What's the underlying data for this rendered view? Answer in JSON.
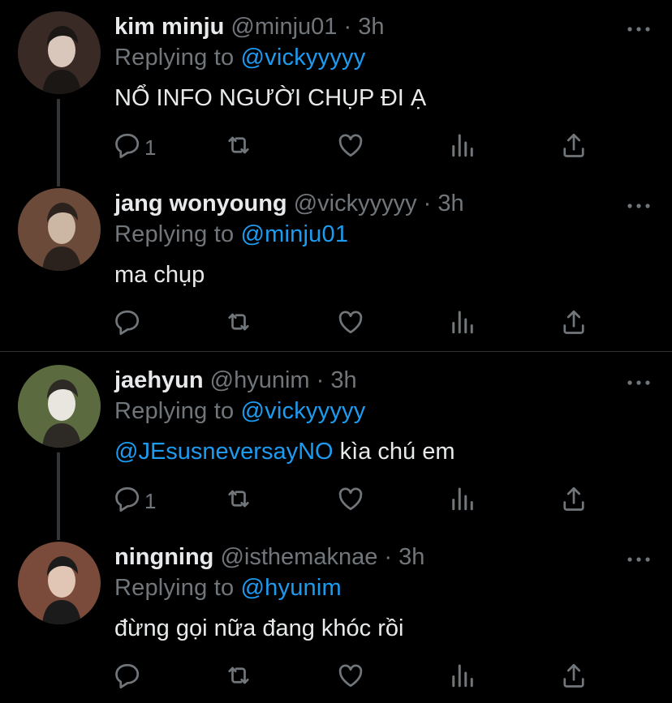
{
  "tweets": [
    {
      "name": "kim minju",
      "handle": "@minju01",
      "sep": " · ",
      "time": "3h",
      "reply_prefix": "Replying to ",
      "reply_to": "@vickyyyyy",
      "mention": "",
      "text": "NỔ INFO NGƯỜI CHỤP ĐI Ạ",
      "reply_count": "1",
      "avatar_colors": [
        "#3a2a25",
        "#d9c7bb",
        "#1b1715"
      ]
    },
    {
      "name": "jang wonyoung",
      "handle": "@vickyyyyy",
      "sep": " · ",
      "time": "3h",
      "reply_prefix": "Replying to ",
      "reply_to": "@minju01",
      "mention": "",
      "text": "ma chụp",
      "reply_count": "",
      "avatar_colors": [
        "#6b4a3a",
        "#cbb7a4",
        "#2b221d"
      ]
    },
    {
      "name": "jaehyun",
      "handle": "@hyunim",
      "sep": " · ",
      "time": "3h",
      "reply_prefix": "Replying to ",
      "reply_to": "@vickyyyyy",
      "mention": "@JEsusneversayNO",
      "text": " kìa chú em",
      "reply_count": "1",
      "avatar_colors": [
        "#5b6a3f",
        "#e9e6df",
        "#2d2a26"
      ]
    },
    {
      "name": "ningning",
      "handle": "@isthemaknae",
      "sep": " · ",
      "time": "3h",
      "reply_prefix": "Replying to ",
      "reply_to": "@hyunim",
      "mention": "",
      "text": "đừng gọi nữa đang khóc rồi",
      "reply_count": "",
      "avatar_colors": [
        "#7a4a3a",
        "#e2c6b5",
        "#1b1b1b"
      ]
    }
  ],
  "colors": {
    "link": "#1d9bf0",
    "muted": "#71767b",
    "text": "#e7e9ea",
    "thread": "#333639"
  },
  "icons": [
    "reply-icon",
    "retweet-icon",
    "like-icon",
    "analytics-icon",
    "share-icon",
    "more-icon"
  ]
}
